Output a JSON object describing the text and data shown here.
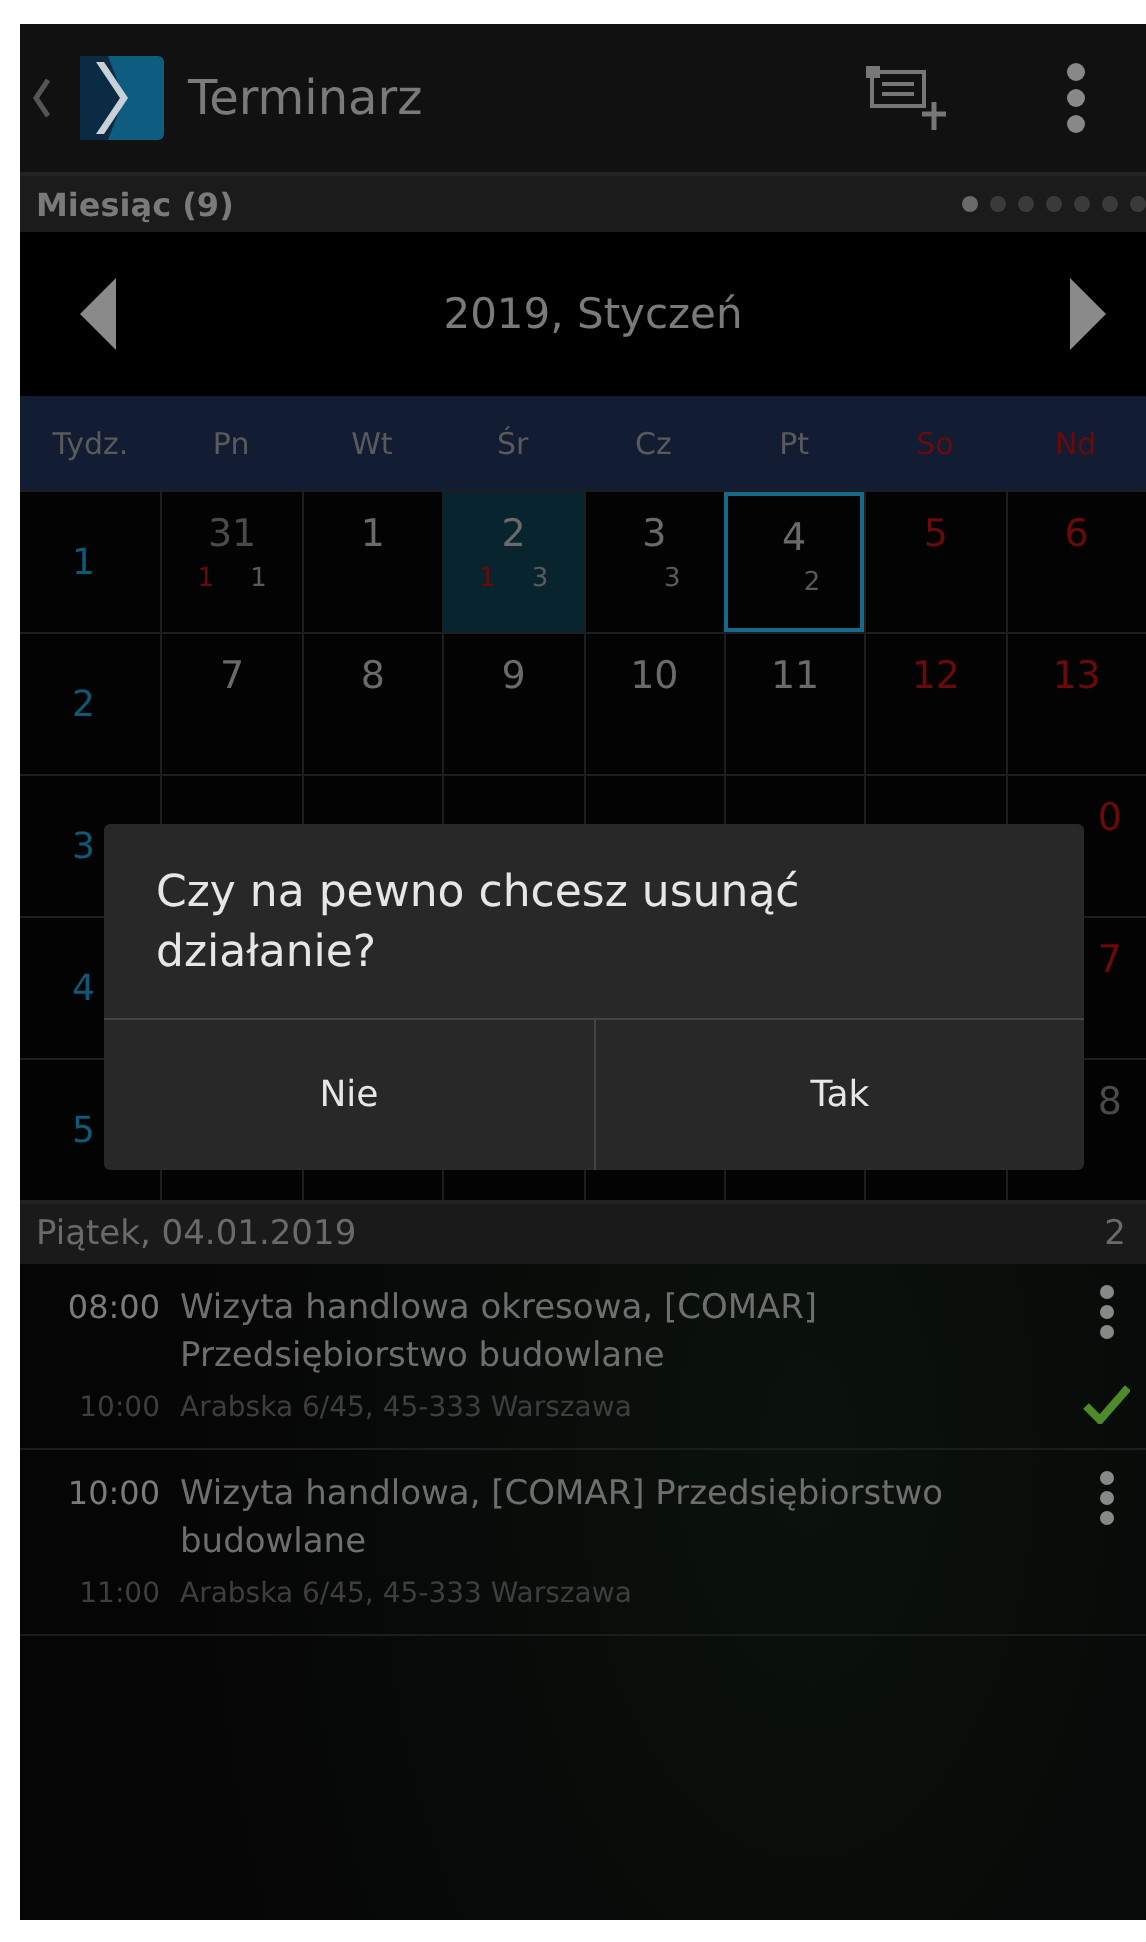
{
  "app_bar": {
    "title": "Terminarz"
  },
  "view_bar": {
    "label": "Miesiąc (9)",
    "pages": [
      {
        "selected": true
      },
      {
        "selected": false
      },
      {
        "selected": false
      },
      {
        "selected": false
      },
      {
        "selected": false
      },
      {
        "selected": false
      },
      {
        "selected": false
      }
    ]
  },
  "month_nav": {
    "title": "2019, Styczeń"
  },
  "calendar": {
    "week_header": "Tydz.",
    "weekdays": [
      {
        "label": "Pn",
        "weekend": false
      },
      {
        "label": "Wt",
        "weekend": false
      },
      {
        "label": "Śr",
        "weekend": false
      },
      {
        "label": "Cz",
        "weekend": false
      },
      {
        "label": "Pt",
        "weekend": false
      },
      {
        "label": "So",
        "weekend": true
      },
      {
        "label": "Nd",
        "weekend": true
      }
    ],
    "weeks": [
      {
        "week": "1",
        "days": [
          {
            "day": "31",
            "other_month": true,
            "red_count": "1",
            "count": "1",
            "selected": false,
            "today": false
          },
          {
            "day": "1",
            "other_month": false,
            "selected": false,
            "today": false
          },
          {
            "day": "2",
            "other_month": false,
            "red_count": "1",
            "count": "3",
            "selected": true,
            "today": false
          },
          {
            "day": "3",
            "other_month": false,
            "count": "3",
            "selected": false,
            "today": false
          },
          {
            "day": "4",
            "other_month": false,
            "count": "2",
            "selected": false,
            "today": true
          },
          {
            "day": "5",
            "other_month": false,
            "selected": false,
            "today": false
          },
          {
            "day": "6",
            "other_month": false,
            "selected": false,
            "today": false
          }
        ]
      },
      {
        "week": "2",
        "days": [
          {
            "day": "7",
            "other_month": false,
            "selected": false,
            "today": false
          },
          {
            "day": "8",
            "other_month": false,
            "selected": false,
            "today": false
          },
          {
            "day": "9",
            "other_month": false,
            "selected": false,
            "today": false
          },
          {
            "day": "10",
            "other_month": false,
            "selected": false,
            "today": false
          },
          {
            "day": "11",
            "other_month": false,
            "selected": false,
            "today": false
          },
          {
            "day": "12",
            "other_month": false,
            "selected": false,
            "today": false
          },
          {
            "day": "13",
            "other_month": false,
            "selected": false,
            "today": false
          }
        ]
      },
      {
        "week": "3",
        "last_day": {
          "day": "0",
          "other_month": false
        }
      },
      {
        "week": "4",
        "last_day": {
          "day": "7",
          "other_month": false
        }
      },
      {
        "week": "5",
        "last_day": {
          "day": "8",
          "other_month": true
        }
      }
    ]
  },
  "dialog": {
    "message": "Czy na pewno chcesz usunąć działanie?",
    "buttons": [
      "Nie",
      "Tak"
    ]
  },
  "day_header": {
    "date": "Piątek, 04.01.2019",
    "count": "2"
  },
  "events": [
    {
      "start": "08:00",
      "end": "10:00",
      "title": "Wizyta handlowa okresowa, [COMAR] Przedsiębiorstwo budowlane",
      "address": "Arabska 6/45, 45-333 Warszawa",
      "done": true
    },
    {
      "start": "10:00",
      "end": "11:00",
      "title": "Wizyta handlowa, [COMAR] Przedsiębiorstwo budowlane",
      "address": "Arabska 6/45, 45-333 Warszawa",
      "done": false
    }
  ]
}
